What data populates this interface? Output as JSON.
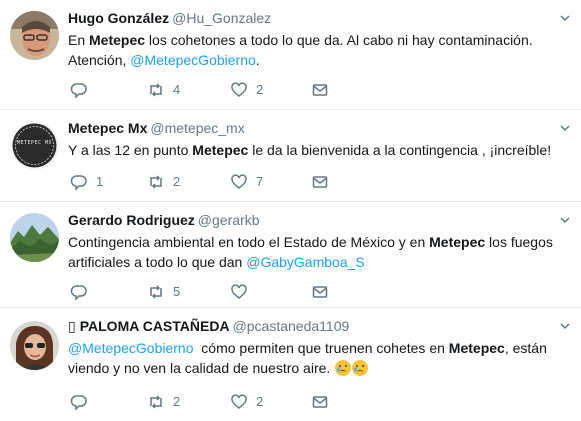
{
  "tweets": [
    {
      "name": "Hugo González",
      "handle": "@Hu_Gonzalez",
      "text_parts": [
        "En ",
        "Metepec",
        " los cohetones a todo lo que da. Al cabo ni hay contaminación. Atención, ",
        "@MetepecGobierno",
        "."
      ],
      "reply_count": "",
      "retweet_count": "4",
      "like_count": "2",
      "avatar": "man-glasses-photo"
    },
    {
      "name": "Metepec Mx",
      "handle": "@metepec_mx",
      "text_parts": [
        "Y a las 12 en punto ",
        "Metepec",
        " le da la bienvenida a la contingencia , ¡increíble!"
      ],
      "reply_count": "1",
      "retweet_count": "2",
      "like_count": "7",
      "avatar": "metepec-logo",
      "avatar_text": "METEPEC MX"
    },
    {
      "name": "Gerardo Rodriguez",
      "handle": "@gerarkb",
      "text_parts": [
        "Contingencia ambiental en todo el Estado de México y en ",
        "Metepec",
        " los fuegos artificiales a todo lo que dan ",
        "@GabyGamboa_S"
      ],
      "reply_count": "",
      "retweet_count": "5",
      "like_count": "",
      "avatar": "mountain-landscape-photo"
    },
    {
      "name": "PALOMA CASTAÑEDA",
      "name_prefix": "▯",
      "handle": "@pcastaneda1109",
      "text_parts": [
        "@MetepecGobierno",
        "  cómo permiten que truenen cohetes en ",
        "Metepec",
        ", están viendo y no ven la calidad de nuestro aire. "
      ],
      "emoji": [
        "crying-face",
        "crying-face"
      ],
      "reply_count": "",
      "retweet_count": "2",
      "like_count": "2",
      "avatar": "woman-photo"
    }
  ],
  "icons": {
    "reply": "reply-icon",
    "retweet": "retweet-icon",
    "like": "heart-icon",
    "dm": "envelope-icon",
    "menu": "chevron-down-icon"
  },
  "colors": {
    "link": "#1da1f2",
    "muted": "#657786",
    "text": "#14171a",
    "border": "#e6ecf0"
  }
}
